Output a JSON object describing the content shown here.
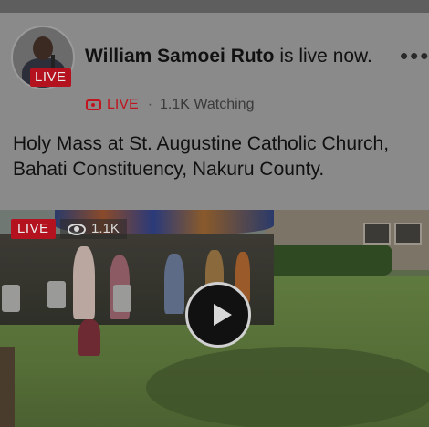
{
  "post": {
    "author": "William Samoei Ruto",
    "status_text": " is live now.",
    "live_badge": "LIVE",
    "live_label": "LIVE",
    "separator": "·",
    "watching": "1.1K Watching",
    "description": "Holy Mass at St. Augustine Catholic Church, Bahati Constituency, Nakuru County.",
    "more_label": "•••"
  },
  "video": {
    "live_badge": "LIVE",
    "views": "1.1K"
  },
  "icons": {
    "avatar": "profile-photo",
    "camera": "live-video-camera-icon",
    "eye": "eye-icon",
    "play": "play-icon",
    "more": "more-options-icon"
  },
  "colors": {
    "live_red": "#b5121f",
    "overlay": "#8a8a8a"
  }
}
